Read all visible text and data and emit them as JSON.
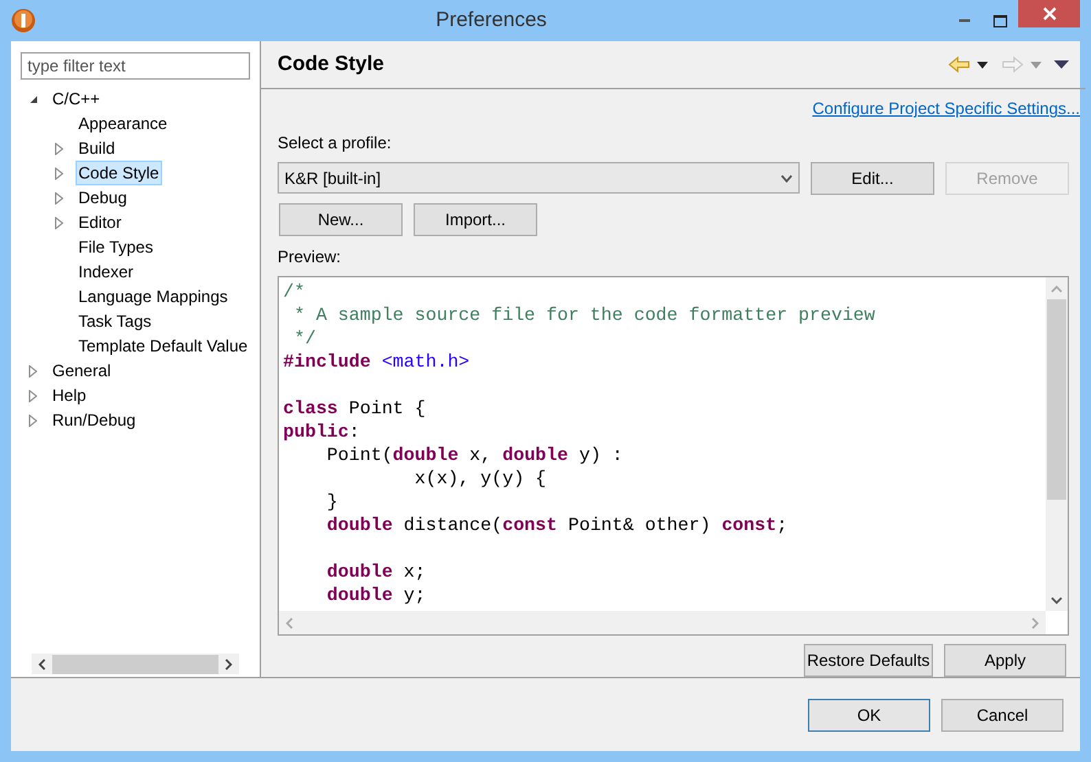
{
  "window": {
    "title": "Preferences"
  },
  "filter": {
    "placeholder": "type filter text"
  },
  "tree": [
    {
      "label": "C/C++",
      "expanded": true,
      "selected": false,
      "children": [
        {
          "label": "Appearance",
          "selected": false
        },
        {
          "label": "Build",
          "expanded": false,
          "selected": false
        },
        {
          "label": "Code Style",
          "expanded": false,
          "selected": true
        },
        {
          "label": "Debug",
          "expanded": false,
          "selected": false
        },
        {
          "label": "Editor",
          "expanded": false,
          "selected": false
        },
        {
          "label": "File Types",
          "selected": false
        },
        {
          "label": "Indexer",
          "selected": false
        },
        {
          "label": "Language Mappings",
          "selected": false
        },
        {
          "label": "Task Tags",
          "selected": false
        },
        {
          "label": "Template Default Value",
          "selected": false
        }
      ]
    },
    {
      "label": "General",
      "expanded": false,
      "selected": false
    },
    {
      "label": "Help",
      "expanded": false,
      "selected": false
    },
    {
      "label": "Run/Debug",
      "expanded": false,
      "selected": false
    }
  ],
  "page": {
    "title": "Code Style",
    "link": "Configure Project Specific Settings...",
    "profile_label": "Select a profile:",
    "profile_value": "K&R [built-in]",
    "buttons": [
      {
        "label": "Edit...",
        "disabled": false
      },
      {
        "label": "Remove",
        "disabled": true
      }
    ],
    "profile_buttons": [
      "New...",
      "Import..."
    ],
    "preview_label": "Preview:",
    "preview_lines": [
      [
        {
          "kind": "comment",
          "text": "/*"
        }
      ],
      [
        {
          "kind": "comment",
          "text": " * A sample source file for the code formatter preview"
        }
      ],
      [
        {
          "kind": "comment",
          "text": " */"
        }
      ],
      [
        {
          "kind": "keyword",
          "text": "#include "
        },
        {
          "kind": "string",
          "text": "<math.h>"
        }
      ],
      [
        {
          "kind": "blank"
        }
      ],
      [
        {
          "kind": "keyword",
          "text": "class"
        },
        {
          "kind": "plain",
          "text": " Point {"
        }
      ],
      [
        {
          "kind": "keyword",
          "text": "public"
        },
        {
          "kind": "plain",
          "text": ":"
        }
      ],
      [
        {
          "kind": "plain",
          "text": "    Point("
        },
        {
          "kind": "keyword",
          "text": "double"
        },
        {
          "kind": "plain",
          "text": " x, "
        },
        {
          "kind": "keyword",
          "text": "double"
        },
        {
          "kind": "plain",
          "text": " y) :"
        }
      ],
      [
        {
          "kind": "plain",
          "text": "            x(x), y(y) {"
        }
      ],
      [
        {
          "kind": "plain",
          "text": "    }"
        }
      ],
      [
        {
          "kind": "keyword",
          "text": "    double"
        },
        {
          "kind": "plain",
          "text": " distance("
        },
        {
          "kind": "keyword",
          "text": "const"
        },
        {
          "kind": "plain",
          "text": " Point& other) "
        },
        {
          "kind": "keyword",
          "text": "const"
        },
        {
          "kind": "plain",
          "text": ";"
        }
      ],
      [
        {
          "kind": "blank"
        }
      ],
      [
        {
          "kind": "keyword",
          "text": "    double"
        },
        {
          "kind": "plain",
          "text": " x;"
        }
      ],
      [
        {
          "kind": "keyword",
          "text": "    double"
        },
        {
          "kind": "plain",
          "text": " y;"
        }
      ]
    ],
    "bottom_buttons": [
      "Restore Defaults",
      "Apply"
    ]
  },
  "dialog_buttons": [
    {
      "label": "OK",
      "default": true
    },
    {
      "label": "Cancel",
      "default": false
    }
  ]
}
